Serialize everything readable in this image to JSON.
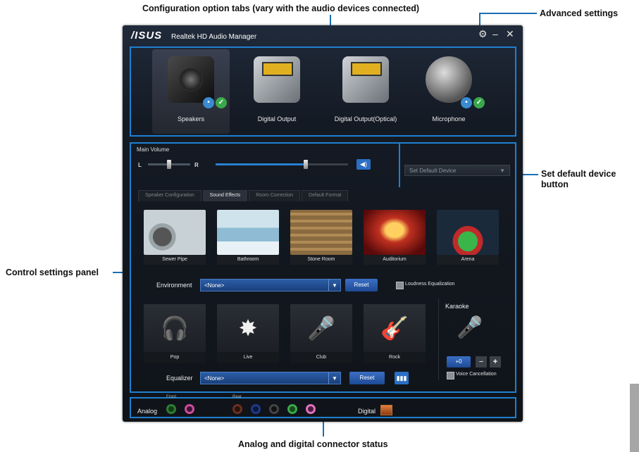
{
  "callouts": {
    "config_tabs": "Configuration option tabs (vary with the audio devices connected)",
    "advanced": "Advanced settings",
    "set_default": "Set default device button",
    "control_panel": "Control settings panel",
    "connector": "Analog and digital connector status"
  },
  "window": {
    "title": "Realtek HD Audio Manager",
    "logo": "/ISUS",
    "icons": [
      "gear-icon",
      "minimize-icon",
      "close-icon"
    ]
  },
  "devices": [
    {
      "label": "Speakers",
      "selected": true
    },
    {
      "label": "Digital Output",
      "selected": false
    },
    {
      "label": "Digital Output(Optical)",
      "selected": false
    },
    {
      "label": "Microphone",
      "selected": false
    }
  ],
  "volume": {
    "label": "Main Volume",
    "left": "L",
    "right": "R",
    "level_fraction": 0.68,
    "balance_fraction": 0.5
  },
  "default_device": "Set Default Device",
  "tabs": [
    "Speaker Configuration",
    "Sound Effects",
    "Room Correction",
    "Default Format"
  ],
  "active_tab": "Sound Effects",
  "environments": [
    "Sewer Pipe",
    "Bathroom",
    "Stone Room",
    "Auditorium",
    "Arena"
  ],
  "environment_row": {
    "label": "Environment",
    "value": "<None>",
    "reset": "Reset",
    "loudness": "Loudness Equalization"
  },
  "eq_presets": [
    "Pop",
    "Live",
    "Club",
    "Rock"
  ],
  "equalizer_row": {
    "label": "Equalizer",
    "value": "<None>",
    "reset": "Reset"
  },
  "karaoke": {
    "title": "Karaoke",
    "value": "+0",
    "minus": "−",
    "plus": "+",
    "voice_cancel": "Voice Cancellation"
  },
  "connectors": {
    "analog": "Analog",
    "front": "Front",
    "rear": "Rear",
    "digital": "Digital",
    "colors": {
      "front_green": "#2e7d32",
      "front_pink": "#d04aa0",
      "rear_brown": "#6b3020",
      "rear_blue": "#1e3a8a",
      "rear_black": "#1a1a1a",
      "rear_green": "#3aa84a",
      "rear_pink": "#e070c0"
    }
  },
  "accent": "#1f7fd0"
}
